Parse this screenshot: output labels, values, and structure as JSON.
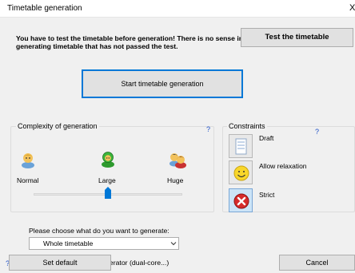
{
  "window": {
    "title": "Timetable generation",
    "close_glyph": "X"
  },
  "warning_text": "You have to test the timetable before generation! There is no sense in generating timetable that has not passed the test.",
  "buttons": {
    "test": "Test the timetable",
    "start": "Start timetable generation",
    "set_default": "Set default",
    "cancel": "Cancel"
  },
  "complexity": {
    "title": "Complexity of generation",
    "help": "?",
    "levels": [
      {
        "label": "Normal",
        "icon": "single-user-icon"
      },
      {
        "label": "Large",
        "icon": "green-user-icon"
      },
      {
        "label": "Huge",
        "icon": "group-users-icon"
      }
    ],
    "selected_level": "Large",
    "slider_value": 0.5
  },
  "constraints": {
    "title": "Constraints",
    "help": "?",
    "options": [
      {
        "label": "Draft",
        "icon": "document-icon",
        "selected": false
      },
      {
        "label": "Allow relaxation",
        "icon": "smiley-icon",
        "selected": false
      },
      {
        "label": "Strict",
        "icon": "red-x-icon",
        "selected": true
      }
    ]
  },
  "generate": {
    "label": "Please choose what do you want to generate:",
    "selected": "Whole timetable"
  },
  "multiprocessor": {
    "help": "?",
    "label": "Enable multiprocessor generator (dual-core...)",
    "checked": true
  },
  "colors": {
    "accent": "#0078d7",
    "help": "#1e50c8",
    "dialog_bg": "#f0f0f0"
  }
}
